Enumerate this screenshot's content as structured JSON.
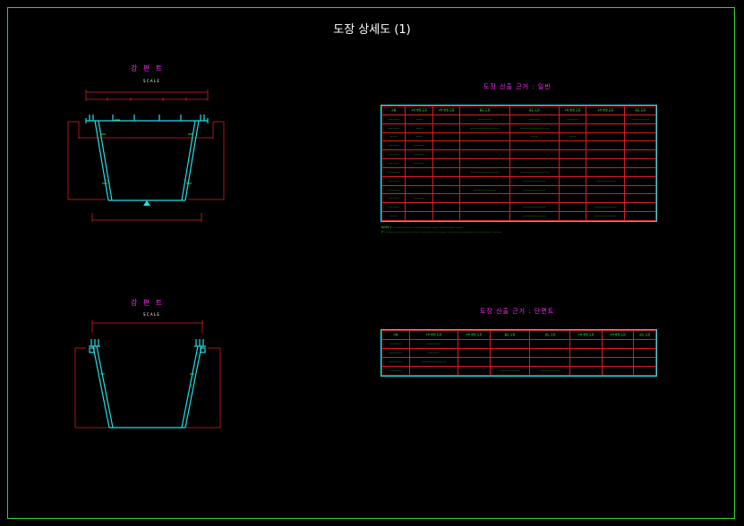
{
  "title": "도장 상세도 (1)",
  "sections": {
    "top_left_label": "강 편 트",
    "top_left_scale": "S C A L E",
    "bottom_left_label": "강 편 트",
    "bottom_left_scale": "S C A L E",
    "table1_title": "도장 산출 근거 : 일반",
    "table2_title": "도장 산출 근거 : 단면트"
  },
  "table1": {
    "header": [
      "구분",
      "1차 방청 도장",
      "2차 방청 도장",
      "중도 도장",
      "상도 도장",
      "1차 방청 도장",
      "2차 방청 도장",
      "상도 도장"
    ],
    "rows": [
      [
        "~~~~~",
        "~~~",
        "",
        "~~~~~~",
        "~~~~~",
        "~~~~~",
        "",
        "~~~~~~~~"
      ],
      [
        "~~~~~",
        "~~~",
        "",
        "~~~~~~~~~~~~~",
        "~~~~~~~~~~~~~",
        "",
        "",
        ""
      ],
      [
        "~~~",
        "~~~",
        "",
        "",
        "~~~",
        "~~~",
        "",
        ""
      ],
      [
        "~~~~~",
        "~~~~~",
        "",
        "",
        "",
        "",
        "",
        ""
      ],
      [
        "~~~~~",
        "~~~~~",
        "",
        "",
        "",
        "",
        "",
        ""
      ],
      [
        "~~~~~",
        "~~~~~",
        "",
        "",
        "",
        "",
        "",
        ""
      ],
      [
        "~~~~~~",
        "",
        "",
        "~~~~~~~~~~~~~",
        "~~~~~~~~~~~~~",
        "",
        "",
        ""
      ],
      [
        "~~~~~",
        "",
        "",
        "",
        "~~~~~~~~~~",
        "",
        "~~~~~~~~~",
        ""
      ],
      [
        "~~~~~~",
        "",
        "",
        "~~~~~~~~~~",
        "~~~~~~~~~~",
        "",
        "",
        ""
      ],
      [
        "~~~~~",
        "~~~~~",
        "",
        "",
        "",
        "",
        "",
        ""
      ],
      [
        "~~~~~",
        "",
        "",
        "",
        "~~~~~~~~~~",
        "",
        "~~~~~~~~~~",
        ""
      ],
      [
        "~~~",
        "",
        "",
        "",
        "~~~~~~~~~~",
        "",
        "~~~~~~~~~~",
        ""
      ]
    ],
    "notes": [
      "NOTE 1 : ~~~~~~~~ ~~~~~~~~ ~~~ ~~~~~~~ ~~~",
      "2 : ~~~~~~~~~~~ ~~~~ ~~~~~~~ ~~~~ ~~~~~~~~~~~~ ~~~~~~~ ~~~~"
    ]
  },
  "table2": {
    "header": [
      "구분",
      "1차 방청 도장",
      "2차 방청 도장",
      "중도 도장",
      "상도 도장",
      "1차 방청 도장",
      "2차 방청 도장",
      "상도 도장"
    ],
    "rows": [
      [
        "~~~~~",
        "~~~~~~",
        "",
        "",
        "",
        "",
        "",
        ""
      ],
      [
        "~~~~~~",
        "~~~~~",
        "",
        "",
        "",
        "",
        "",
        ""
      ],
      [
        "~~~~~~",
        "~~~~~~~~~~~",
        "",
        "",
        "",
        "",
        "",
        ""
      ],
      [
        "~~~~~~",
        "",
        "",
        "~~~~~~~~~",
        "~~~~~~~~~",
        "",
        "",
        ""
      ]
    ]
  },
  "colors": {
    "frame": "#39d12b",
    "cyan": "#22e0e6",
    "red": "#d61f1f",
    "magenta": "#ff2bff",
    "green": "#3dfc3d"
  }
}
